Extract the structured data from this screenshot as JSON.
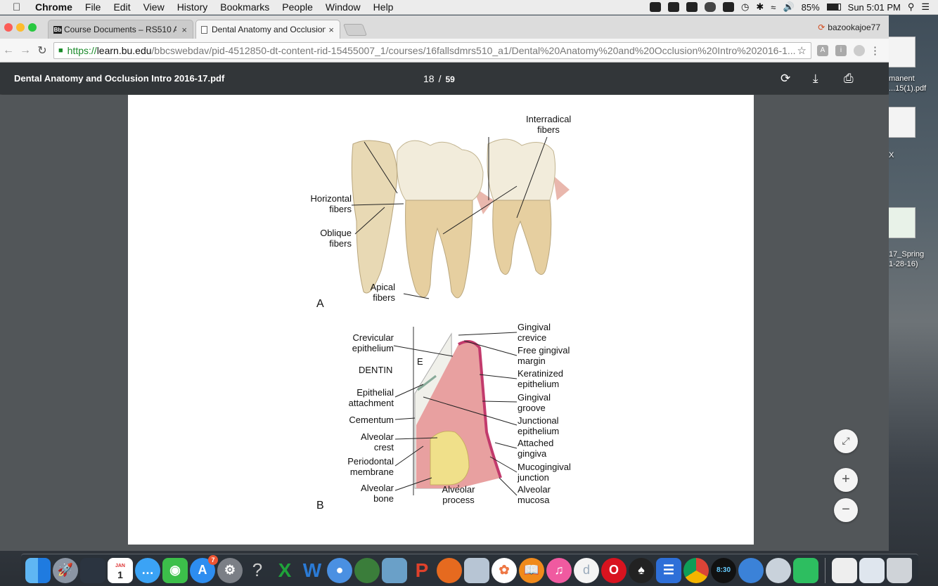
{
  "menubar": {
    "app": "Chrome",
    "items": [
      "File",
      "Edit",
      "View",
      "History",
      "Bookmarks",
      "People",
      "Window",
      "Help"
    ],
    "battery": "85%",
    "clock": "Sun 5:01 PM"
  },
  "browser": {
    "tabs": [
      {
        "label": "Course Documents – RS510 A",
        "icon": "blackboard-icon"
      },
      {
        "label": "Dental Anatomy and Occlusion",
        "icon": "document-icon"
      }
    ],
    "profile": "bazookajoe77",
    "url": {
      "scheme": "https://",
      "host": "learn.bu.edu",
      "path": "/bbcswebdav/pid-4512850-dt-content-rid-15455007_1/courses/16fallsdmrs510_a1/Dental%20Anatomy%20and%20Occlusion%20Intro%202016-1..."
    }
  },
  "pdf": {
    "title": "Dental Anatomy and Occlusion Intro 2016-17.pdf",
    "current_page": "18",
    "separator": "/",
    "total_pages": "59"
  },
  "figure": {
    "labels_a": {
      "interradical": [
        "Interradical",
        "fibers"
      ],
      "horizontal": [
        "Horizontal",
        "fibers"
      ],
      "oblique": [
        "Oblique",
        "fibers"
      ],
      "apical": [
        "Apical",
        "fibers"
      ],
      "panel": "A"
    },
    "labels_b": {
      "crevicular": [
        "Crevicular",
        "epithelium"
      ],
      "dentin": "DENTIN",
      "e": "E",
      "epithelial": [
        "Epithelial",
        "attachment"
      ],
      "cementum": "Cementum",
      "alveolar_crest": [
        "Alveolar",
        "crest"
      ],
      "periodontal": [
        "Periodontal",
        "membrane"
      ],
      "alveolar_bone": [
        "Alveolar",
        "bone"
      ],
      "alveolar_process": [
        "Alveolar",
        "process"
      ],
      "gingival_crevice": [
        "Gingival",
        "crevice"
      ],
      "free_margin": [
        "Free gingival",
        "margin"
      ],
      "keratinized": [
        "Keratinized",
        "epithelium"
      ],
      "gingival_groove": [
        "Gingival",
        "groove"
      ],
      "junctional": [
        "Junctional",
        "epithelium"
      ],
      "attached": [
        "Attached",
        "gingiva"
      ],
      "mucogingival": [
        "Mucogingival",
        "junction"
      ],
      "mucosa": [
        "Alveolar",
        "mucosa"
      ],
      "panel": "B"
    }
  },
  "desktop": {
    "labels": [
      "manent",
      "...15(1).pdf",
      "X",
      "17_Spring",
      "1-28-16)"
    ]
  },
  "dock": {
    "calendar_day": "1",
    "calendar_month": "JAN",
    "appstore_badge": "7",
    "clock_widget": "8:30",
    "help_glyph": "?"
  }
}
